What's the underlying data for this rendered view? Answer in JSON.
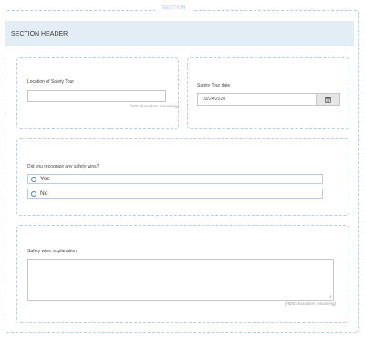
{
  "section": {
    "legend": "SECTION",
    "header": "SECTION HEADER"
  },
  "location": {
    "label": "Location of Safety Tour",
    "value": "",
    "hint": "(200 characters remaining)"
  },
  "tour_date": {
    "label": "Safety Tour date",
    "value": "03/24/2020",
    "icon": "calendar-icon"
  },
  "safety_wins": {
    "question": "Did you recognize any safety wins?",
    "options": [
      {
        "label": "Yes"
      },
      {
        "label": "No"
      }
    ]
  },
  "explanation": {
    "label": "Safety wins: explanation",
    "value": "",
    "hint": "(4000 characters remaining)"
  },
  "colors": {
    "header_bg": "#e3edf6",
    "border": "#b7cde3",
    "radio": "#4a7fb4"
  }
}
